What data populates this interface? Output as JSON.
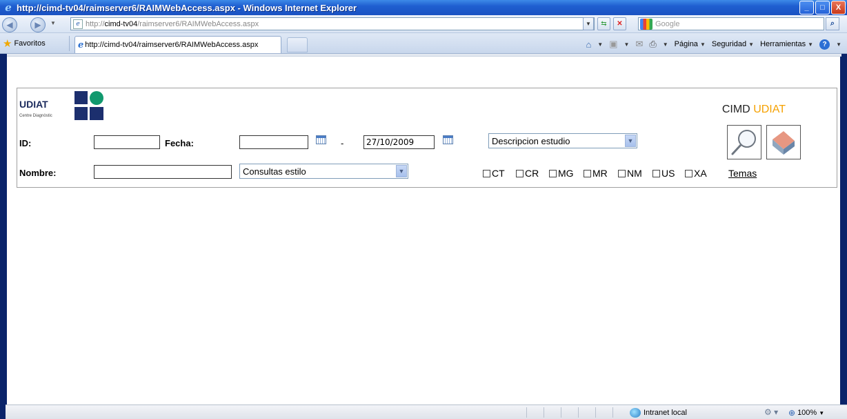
{
  "window": {
    "title": "http://cimd-tv04/raimserver6/RAIMWebAccess.aspx - Windows Internet Explorer",
    "buttons": {
      "minimize": "_",
      "maximize": "□",
      "close": "X"
    }
  },
  "addressbar": {
    "url_prefix": "http://",
    "url_domain": "cimd-tv04",
    "url_path": "/raimserver6/RAIMWebAccess.aspx",
    "search_placeholder": "Google"
  },
  "favbar": {
    "favorites_label": "Favoritos",
    "tab_title": "http://cimd-tv04/raimserver6/RAIMWebAccess.aspx",
    "commands": {
      "pagina": "Página",
      "seguridad": "Seguridad",
      "herramientas": "Herramientas"
    }
  },
  "app": {
    "logo_name": "UDIAT",
    "logo_subtitle": "Centre Diagnòstic",
    "brand_prefix": "CIMD",
    "brand_accent": "UDIAT",
    "brand_accent_color": "#f5a100",
    "form": {
      "id_label": "ID:",
      "id_value": "",
      "fecha_label": "Fecha:",
      "fecha_from": "",
      "fecha_separator": "-",
      "fecha_to": "27/10/2009",
      "descripcion_select": "Descripcion estudio",
      "nombre_label": "Nombre:",
      "nombre_value": "",
      "consultas_select": "Consultas estilo",
      "modalities": [
        "CT",
        "CR",
        "MG",
        "MR",
        "NM",
        "US",
        "XA"
      ],
      "temas_link": "Temas"
    }
  },
  "statusbar": {
    "zone": "Intranet local",
    "zoom": "100%"
  }
}
